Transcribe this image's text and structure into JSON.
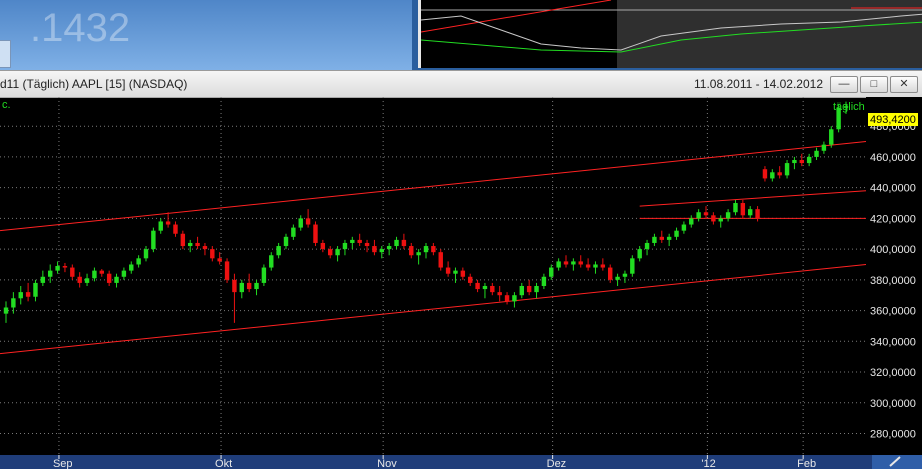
{
  "top": {
    "big_value": ".1432"
  },
  "window": {
    "title": "d11 (Täglich)  AAPL [15] (NASDAQ)",
    "date_range": "11.08.2011 - 14.02.2012",
    "corner_label": "c.",
    "minimize_icon": "minimize-icon",
    "restore_icon": "restore-icon",
    "close_icon": "close-icon"
  },
  "colors": {
    "background": "#000000",
    "up": "#22dd22",
    "down": "#ee1111",
    "channel": "#ff2222",
    "grid": "#7a7a7a",
    "label": "#e8e8e8",
    "axis_bar": "#1f3d7a",
    "last_price_box": "#ffff00",
    "period_label": "#22dd22"
  },
  "chart_data": {
    "type": "candlestick",
    "symbol": "AAPL",
    "period_label": "täglich",
    "last_price": "493,4200",
    "x_labels": [
      "Sep",
      "Okt",
      "Nov",
      "Dez",
      "'12",
      "Feb"
    ],
    "y_ticks": [
      "280,0000",
      "300,0000",
      "320,0000",
      "340,0000",
      "360,0000",
      "380,0000",
      "400,0000",
      "420,0000",
      "440,0000",
      "460,0000",
      "480,0000"
    ],
    "y_range": [
      266,
      499
    ],
    "grid": "dotted",
    "candles": [
      [
        358,
        366,
        352,
        362
      ],
      [
        362,
        372,
        358,
        368
      ],
      [
        368,
        376,
        364,
        372
      ],
      [
        372,
        378,
        366,
        369
      ],
      [
        369,
        380,
        366,
        378
      ],
      [
        378,
        386,
        376,
        382
      ],
      [
        382,
        390,
        378,
        386
      ],
      [
        386,
        392,
        384,
        389
      ],
      [
        389,
        391,
        385,
        388
      ],
      [
        388,
        390,
        380,
        382
      ],
      [
        382,
        385,
        375,
        378
      ],
      [
        378,
        384,
        376,
        381
      ],
      [
        381,
        388,
        379,
        386
      ],
      [
        386,
        387,
        382,
        384
      ],
      [
        384,
        386,
        376,
        378
      ],
      [
        378,
        384,
        375,
        382
      ],
      [
        382,
        388,
        380,
        386
      ],
      [
        386,
        392,
        384,
        390
      ],
      [
        390,
        396,
        388,
        394
      ],
      [
        394,
        402,
        392,
        400
      ],
      [
        400,
        414,
        398,
        412
      ],
      [
        412,
        420,
        410,
        418
      ],
      [
        418,
        424,
        414,
        416
      ],
      [
        416,
        418,
        408,
        410
      ],
      [
        410,
        412,
        400,
        402
      ],
      [
        402,
        406,
        398,
        404
      ],
      [
        404,
        408,
        400,
        402
      ],
      [
        402,
        404,
        396,
        400
      ],
      [
        400,
        402,
        392,
        394
      ],
      [
        394,
        398,
        390,
        392
      ],
      [
        392,
        394,
        378,
        380
      ],
      [
        380,
        384,
        352,
        372
      ],
      [
        372,
        380,
        368,
        378
      ],
      [
        378,
        384,
        372,
        374
      ],
      [
        374,
        380,
        370,
        378
      ],
      [
        378,
        390,
        376,
        388
      ],
      [
        388,
        398,
        386,
        396
      ],
      [
        396,
        404,
        394,
        402
      ],
      [
        402,
        410,
        400,
        408
      ],
      [
        408,
        416,
        406,
        414
      ],
      [
        414,
        422,
        412,
        420
      ],
      [
        420,
        426,
        414,
        416
      ],
      [
        416,
        418,
        402,
        404
      ],
      [
        404,
        406,
        398,
        400
      ],
      [
        400,
        402,
        394,
        396
      ],
      [
        396,
        402,
        392,
        400
      ],
      [
        400,
        406,
        396,
        404
      ],
      [
        404,
        408,
        400,
        406
      ],
      [
        406,
        410,
        402,
        404
      ],
      [
        404,
        406,
        398,
        402
      ],
      [
        402,
        406,
        396,
        398
      ],
      [
        398,
        402,
        394,
        400
      ],
      [
        400,
        404,
        396,
        402
      ],
      [
        402,
        408,
        400,
        406
      ],
      [
        406,
        410,
        400,
        402
      ],
      [
        402,
        404,
        394,
        396
      ],
      [
        396,
        400,
        390,
        398
      ],
      [
        398,
        404,
        394,
        402
      ],
      [
        402,
        404,
        396,
        398
      ],
      [
        398,
        400,
        386,
        388
      ],
      [
        388,
        392,
        382,
        384
      ],
      [
        384,
        388,
        378,
        386
      ],
      [
        386,
        388,
        380,
        382
      ],
      [
        382,
        384,
        376,
        378
      ],
      [
        378,
        380,
        372,
        374
      ],
      [
        374,
        378,
        368,
        376
      ],
      [
        376,
        378,
        370,
        372
      ],
      [
        372,
        376,
        366,
        370
      ],
      [
        370,
        372,
        364,
        366
      ],
      [
        366,
        372,
        362,
        370
      ],
      [
        370,
        378,
        368,
        376
      ],
      [
        376,
        380,
        370,
        372
      ],
      [
        372,
        378,
        368,
        376
      ],
      [
        376,
        384,
        374,
        382
      ],
      [
        382,
        390,
        380,
        388
      ],
      [
        388,
        394,
        386,
        392
      ],
      [
        392,
        396,
        388,
        390
      ],
      [
        390,
        394,
        386,
        392
      ],
      [
        392,
        396,
        388,
        390
      ],
      [
        390,
        394,
        386,
        388
      ],
      [
        388,
        392,
        384,
        390
      ],
      [
        390,
        394,
        386,
        388
      ],
      [
        388,
        390,
        378,
        380
      ],
      [
        380,
        384,
        376,
        382
      ],
      [
        382,
        386,
        378,
        384
      ],
      [
        384,
        396,
        382,
        394
      ],
      [
        394,
        402,
        392,
        400
      ],
      [
        400,
        406,
        396,
        404
      ],
      [
        404,
        410,
        402,
        408
      ],
      [
        408,
        412,
        404,
        406
      ],
      [
        406,
        410,
        402,
        408
      ],
      [
        408,
        414,
        406,
        412
      ],
      [
        412,
        418,
        410,
        416
      ],
      [
        416,
        422,
        414,
        420
      ],
      [
        420,
        426,
        418,
        424
      ],
      [
        424,
        428,
        420,
        422
      ],
      [
        422,
        424,
        416,
        418
      ],
      [
        418,
        422,
        414,
        420
      ],
      [
        420,
        426,
        418,
        424
      ],
      [
        424,
        432,
        422,
        430
      ],
      [
        430,
        432,
        420,
        422
      ],
      [
        422,
        428,
        420,
        426
      ],
      [
        426,
        428,
        418,
        420
      ],
      [
        452,
        454,
        444,
        446
      ],
      [
        446,
        452,
        444,
        450
      ],
      [
        450,
        454,
        446,
        448
      ],
      [
        448,
        458,
        446,
        456
      ],
      [
        456,
        460,
        452,
        458
      ],
      [
        458,
        462,
        454,
        456
      ],
      [
        456,
        462,
        454,
        460
      ],
      [
        460,
        466,
        458,
        464
      ],
      [
        464,
        470,
        462,
        468
      ],
      [
        468,
        480,
        466,
        478
      ],
      [
        478,
        494,
        476,
        492
      ],
      [
        492,
        496,
        488,
        493
      ]
    ],
    "channel_lines": [
      {
        "x0": 0,
        "y0": 412,
        "x1": 117,
        "y1": 470
      },
      {
        "x0": 0,
        "y0": 332,
        "x1": 117,
        "y1": 390
      },
      {
        "x0": 86,
        "y0": 428,
        "x1": 117,
        "y1": 438
      },
      {
        "x0": 86,
        "y0": 420,
        "x1": 117,
        "y1": 420
      }
    ]
  }
}
